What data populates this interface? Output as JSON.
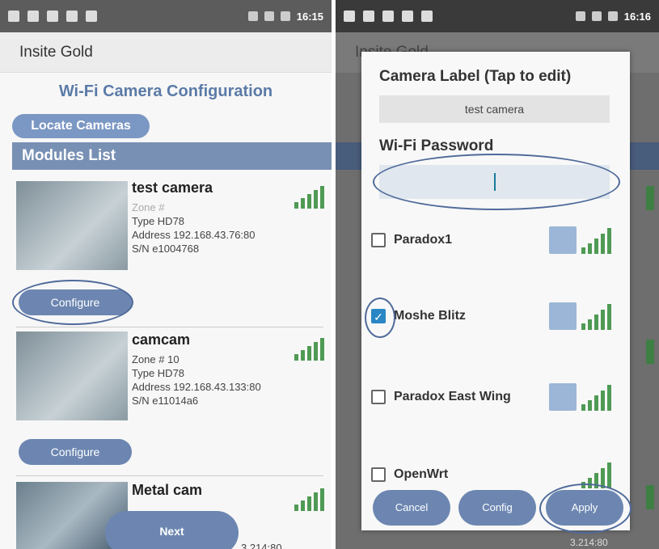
{
  "left": {
    "status_time": "16:15",
    "app_title": "Insite Gold",
    "page_title": "Wi-Fi Camera Configuration",
    "locate_label": "Locate Cameras",
    "modules_header": "Modules List",
    "modules": [
      {
        "name": "test camera",
        "zone": "Zone #",
        "type": "Type HD78",
        "address": "Address 192.168.43.76:80",
        "sn": "S/N e1004768",
        "configure": "Configure"
      },
      {
        "name": "camcam",
        "zone": "Zone # 10",
        "type": "Type HD78",
        "address": "Address 192.168.43.133:80",
        "sn": "S/N e11014a6",
        "configure": "Configure"
      },
      {
        "name": "Metal cam",
        "address_tail": "3.214:80"
      }
    ],
    "next_label": "Next"
  },
  "right": {
    "status_time": "16:16",
    "app_title": "Insite Gold",
    "dialog": {
      "label_heading": "Camera Label (Tap to edit)",
      "label_value": "test camera",
      "password_heading": "Wi-Fi Password",
      "password_value": "",
      "networks": [
        {
          "name": "Paradox1",
          "checked": false
        },
        {
          "name": "Moshe Blitz",
          "checked": true
        },
        {
          "name": "Paradox East Wing",
          "checked": false
        },
        {
          "name": "OpenWrt",
          "checked": false
        }
      ],
      "buttons": {
        "cancel": "Cancel",
        "config": "Config",
        "apply": "Apply"
      }
    },
    "bg_tail": "3.214:80"
  },
  "colors": {
    "accent": "#6c86b1",
    "header": "#7890b3",
    "signal": "#4f9a54",
    "highlight_ring": "#4f6a9a"
  }
}
